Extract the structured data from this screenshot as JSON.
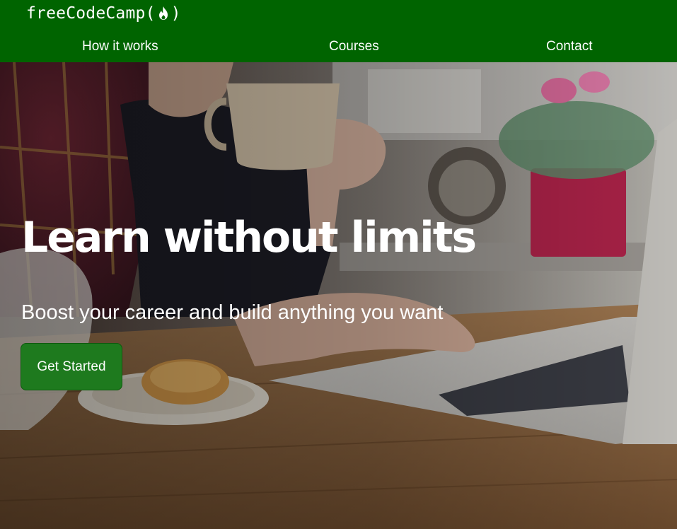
{
  "header": {
    "logo_text": "freeCodeCamp",
    "logo_open": "(",
    "logo_close": ")",
    "logo_icon": "flame-icon",
    "background_color": "#006400"
  },
  "nav": {
    "items": [
      {
        "label": "How it works"
      },
      {
        "label": "Courses"
      },
      {
        "label": "Contact"
      }
    ]
  },
  "hero": {
    "title": "Learn without limits",
    "subtitle": "Boost your career and build anything you want",
    "cta_label": "Get Started",
    "cta_color": "#1e7a1e"
  }
}
